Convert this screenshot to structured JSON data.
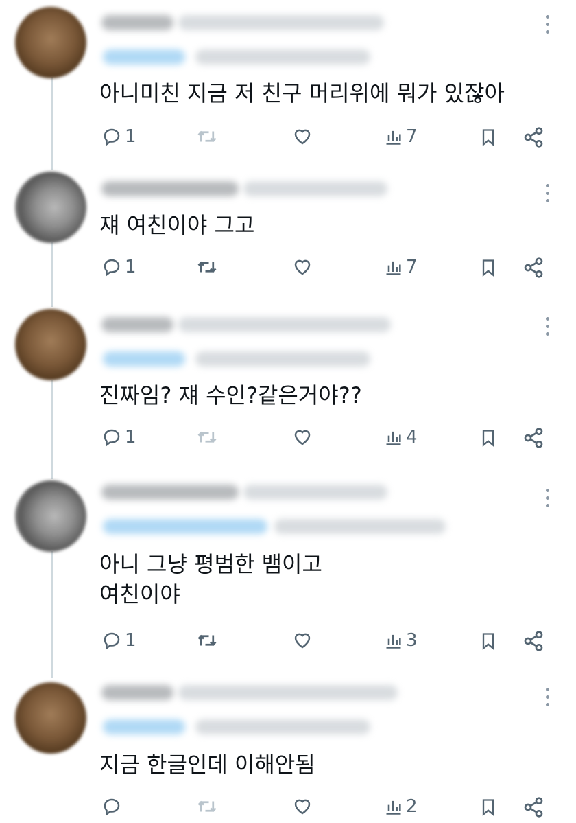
{
  "thread": [
    {
      "text": "아니미친 지금 저 친구 머리위에 뭐가 있잖아",
      "replies": "1",
      "views": "7",
      "repost_muted": true,
      "avatar": "brown"
    },
    {
      "text": "쟤 여친이야 그고",
      "replies": "1",
      "views": "7",
      "repost_muted": false,
      "avatar": "gray"
    },
    {
      "text": "진짜임? 쟤 수인?같은거야??",
      "replies": "1",
      "views": "4",
      "repost_muted": true,
      "avatar": "brown"
    },
    {
      "text": "아니 그냥 평범한 뱀이고\n여친이야",
      "replies": "1",
      "views": "3",
      "repost_muted": false,
      "avatar": "gray"
    },
    {
      "text": "지금 한글인데 이해안됨",
      "replies": "",
      "views": "2",
      "repost_muted": true,
      "avatar": "brown"
    }
  ],
  "colors": {
    "text": "#0f1419",
    "icon": "#536471",
    "thread_line": "#cfd9de"
  },
  "icons": [
    "reply-icon",
    "repost-icon",
    "like-icon",
    "views-icon",
    "bookmark-icon",
    "share-icon",
    "more-icon"
  ]
}
